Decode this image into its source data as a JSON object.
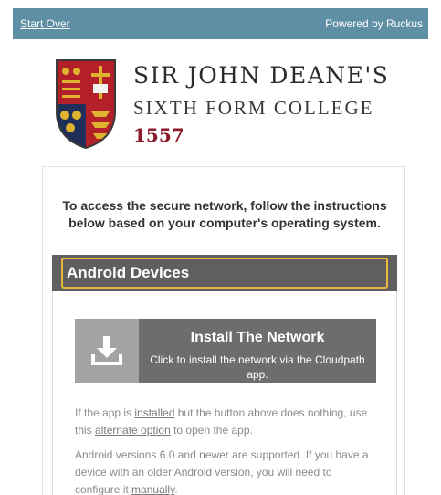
{
  "topbar": {
    "start_over": "Start Over",
    "powered_by": "Powered by Ruckus"
  },
  "branding": {
    "line1": "SIR JOHN DEANE'S",
    "line2": "SIXTH FORM COLLEGE",
    "year": "1557",
    "crest_icon": "college-crest-icon"
  },
  "intro": "To access the secure network, follow the instructions below based on your computer's operating system.",
  "section": {
    "title": "Android Devices"
  },
  "install": {
    "title": "Install The Network",
    "subtitle": "Click to install the network via the Cloudpath app.",
    "icon": "download-icon"
  },
  "help1": {
    "pre": "If the app is ",
    "link1": "installed",
    "mid": " but the button above does nothing, use this ",
    "link2": "alternate option",
    "post": " to open the app."
  },
  "help2": {
    "pre": "Android versions 6.0 and newer are supported. If you have a device with an older Android version, you will need to configure it ",
    "link": "manually",
    "post": "."
  },
  "colors": {
    "topbar": "#5e8fa5",
    "section_header": "#5f5f5f",
    "focus_outline": "#e8b83a",
    "crest_red": "#b3202a",
    "crest_navy": "#1f2f5a",
    "crest_gold": "#e0b32e",
    "year_maroon": "#8b1a2b"
  }
}
